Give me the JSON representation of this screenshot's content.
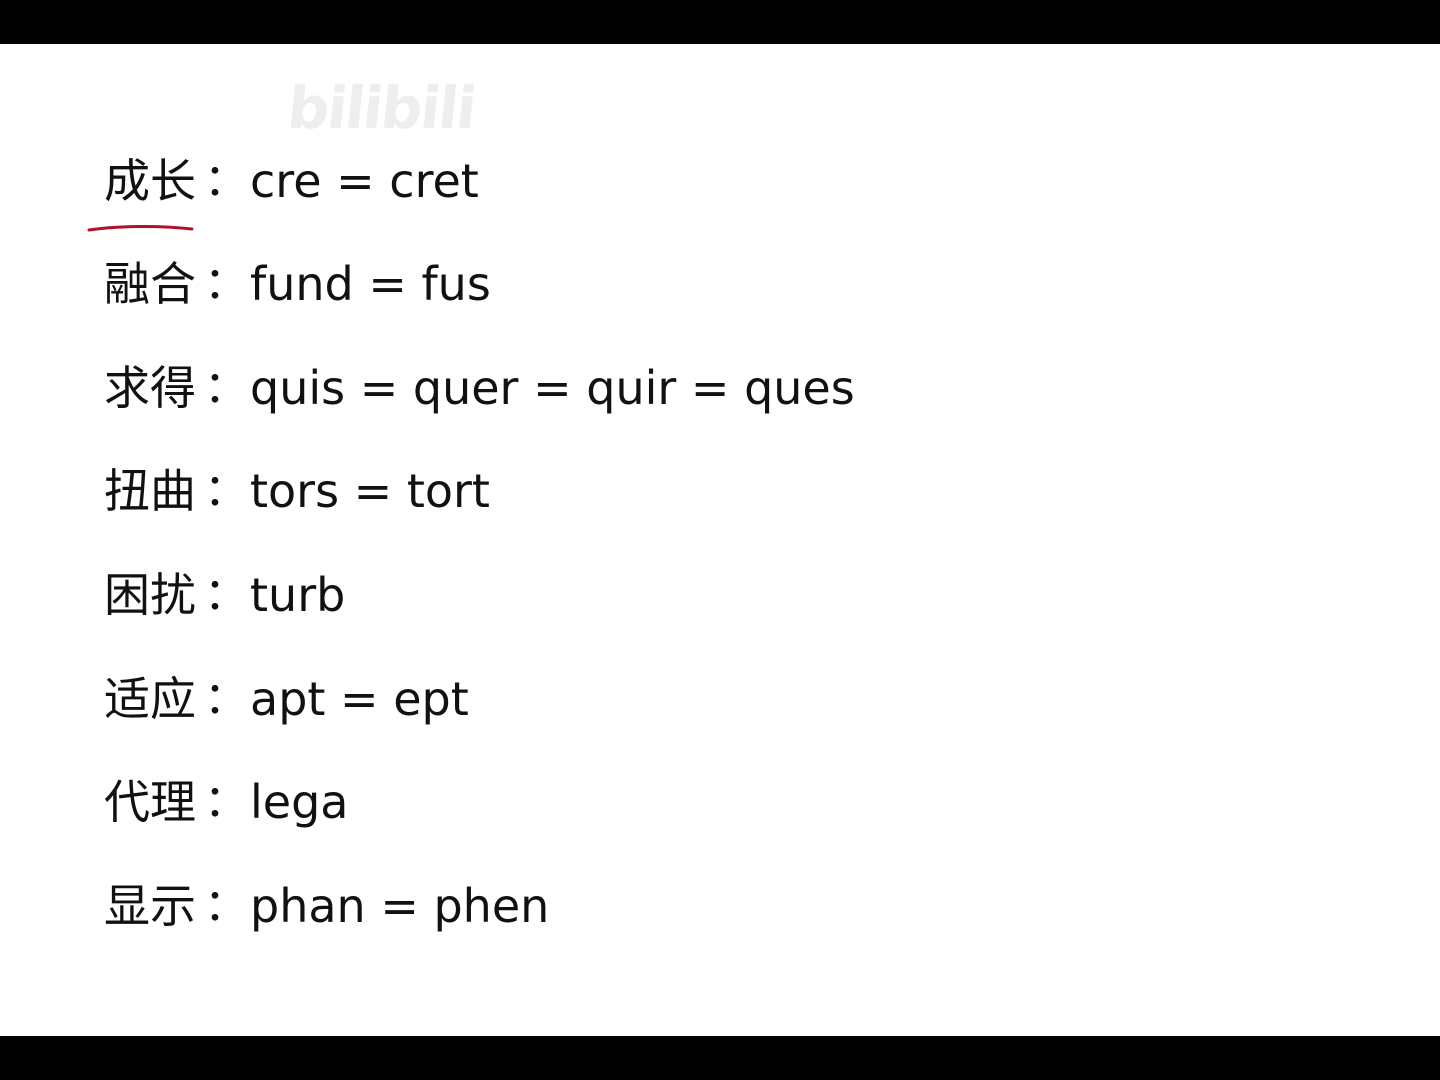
{
  "watermark": "bilibili",
  "rows": [
    {
      "zh": "成长",
      "colon": "：",
      "en": "cre = cret"
    },
    {
      "zh": "融合",
      "colon": "：",
      "en": "fund = fus"
    },
    {
      "zh": "求得",
      "colon": "：",
      "en": "quis = quer = quir = ques"
    },
    {
      "zh": "扭曲",
      "colon": "：",
      "en": "tors = tort"
    },
    {
      "zh": "困扰",
      "colon": "：",
      "en": "turb"
    },
    {
      "zh": "适应",
      "colon": "：",
      "en": "apt = ept"
    },
    {
      "zh": "代理",
      "colon": "：",
      "en": "lega"
    },
    {
      "zh": "显示",
      "colon": "：",
      "en": "phan = phen"
    }
  ],
  "colors": {
    "letterbox": "#000000",
    "page": "#ffffff",
    "text": "#111111",
    "underline_ink": "#b0122a",
    "watermark": "#eeeeee"
  }
}
